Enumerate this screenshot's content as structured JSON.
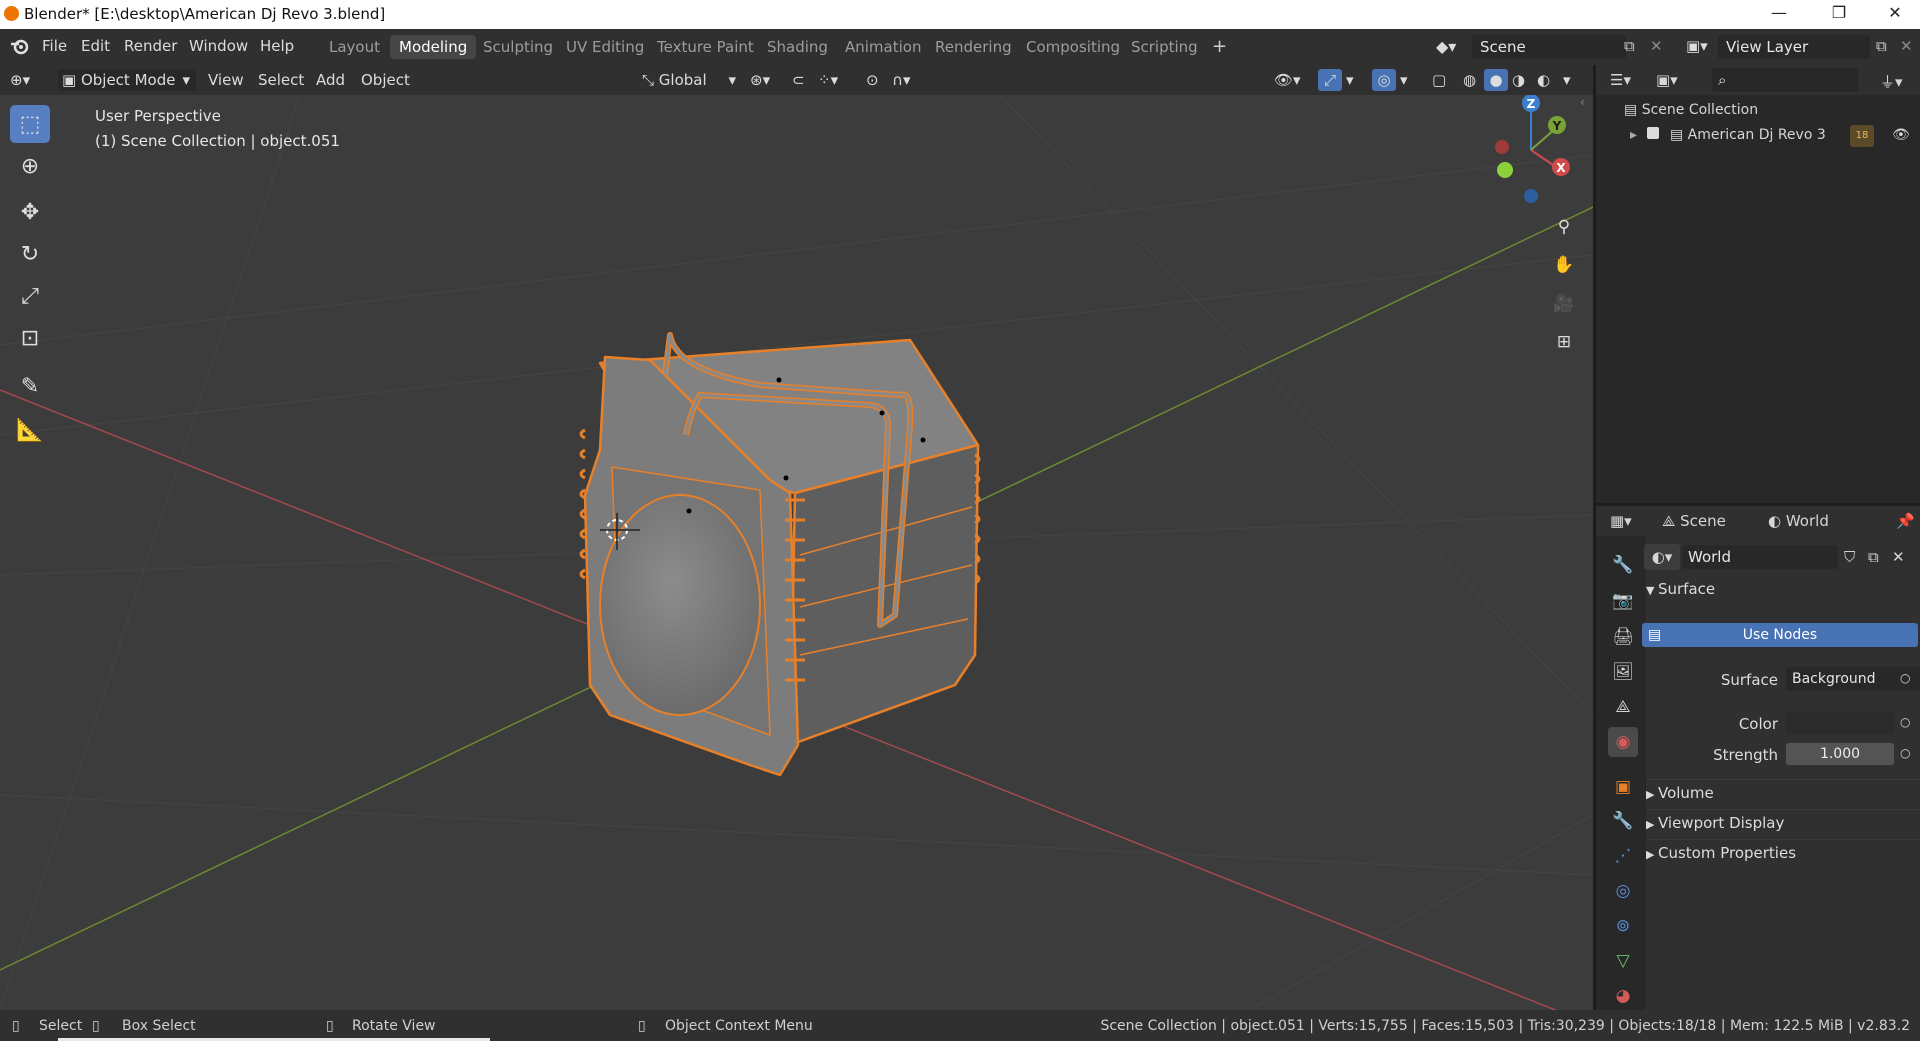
{
  "window": {
    "title": "Blender* [E:\\desktop\\American Dj Revo 3.blend]",
    "controls": [
      "—",
      "❐",
      "✕"
    ]
  },
  "menu": [
    "File",
    "Edit",
    "Render",
    "Window",
    "Help"
  ],
  "workspaces": [
    {
      "label": "Layout",
      "active": false
    },
    {
      "label": "Modeling",
      "active": true
    },
    {
      "label": "Sculpting",
      "active": false
    },
    {
      "label": "UV Editing",
      "active": false
    },
    {
      "label": "Texture Paint",
      "active": false
    },
    {
      "label": "Shading",
      "active": false
    },
    {
      "label": "Animation",
      "active": false
    },
    {
      "label": "Rendering",
      "active": false
    },
    {
      "label": "Compositing",
      "active": false
    },
    {
      "label": "Scripting",
      "active": false
    }
  ],
  "add_workspace": "+",
  "scene_name": "Scene",
  "view_layer": "View Layer",
  "viewport_header": {
    "mode": "Object Mode",
    "menus": [
      "View",
      "Select",
      "Add",
      "Object"
    ],
    "orientation": "Global"
  },
  "viewport": {
    "overlay_line1": "User Perspective",
    "overlay_line2": "(1) Scene Collection | object.051",
    "gizmo_axes": {
      "x": "X",
      "y": "Y",
      "z": "Z"
    }
  },
  "outliner": {
    "root": "Scene Collection",
    "items": [
      {
        "label": "American Dj Revo 3",
        "badge": "18"
      }
    ]
  },
  "properties": {
    "scene_label": "Scene",
    "world_label": "World",
    "world_name": "World",
    "surface_section": "Surface",
    "use_nodes": "Use Nodes",
    "surface_label": "Surface",
    "surface_value": "Background",
    "color_label": "Color",
    "strength_label": "Strength",
    "strength_value": "1.000",
    "collapsed_sections": [
      "Volume",
      "Viewport Display",
      "Custom Properties"
    ]
  },
  "statusbar": {
    "select": "Select",
    "box_select": "Box Select",
    "rotate_view": "Rotate View",
    "context_menu": "Object Context Menu",
    "stats": "Scene Collection | object.051 | Verts:15,755 | Faces:15,503 | Tris:30,239 | Objects:18/18 | Mem: 122.5 MiB | v2.83.2"
  },
  "colors": {
    "accent_blue": "#4772b3",
    "selection_orange": "#e8802a",
    "axis_red": "#d04a4a",
    "axis_green": "#7aa236",
    "axis_blue": "#3d7fcf"
  }
}
